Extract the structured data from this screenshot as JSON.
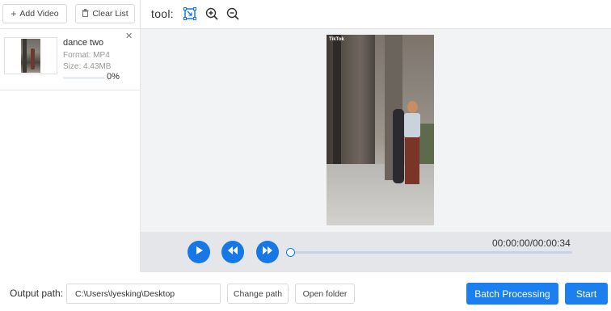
{
  "toolbar": {
    "add_video_label": "Add Video",
    "clear_list_label": "Clear List",
    "tool_label": "tool:",
    "icons": [
      "fit-to-frame-icon",
      "zoom-in-icon",
      "zoom-out-icon"
    ]
  },
  "file_list": {
    "items": [
      {
        "name": "dance two",
        "format": "Format:  MP4",
        "size": "Size:  4.43MB",
        "progress_text": "0%",
        "progress": 0
      }
    ]
  },
  "preview": {
    "watermark": "TikTok"
  },
  "player": {
    "time": "00:00:00/00:00:34",
    "position_fraction": 0
  },
  "bottom": {
    "output_label": "Output path:",
    "output_path": "C:\\Users\\lyesking\\Desktop",
    "change_path_label": "Change path",
    "open_folder_label": "Open folder",
    "batch_label": "Batch Processing",
    "start_label": "Start"
  },
  "colors": {
    "accent": "#1677e5",
    "primary_button": "#1b7ff0",
    "preview_bg": "#f2f3f5",
    "player_bg": "#e4e6ea"
  }
}
